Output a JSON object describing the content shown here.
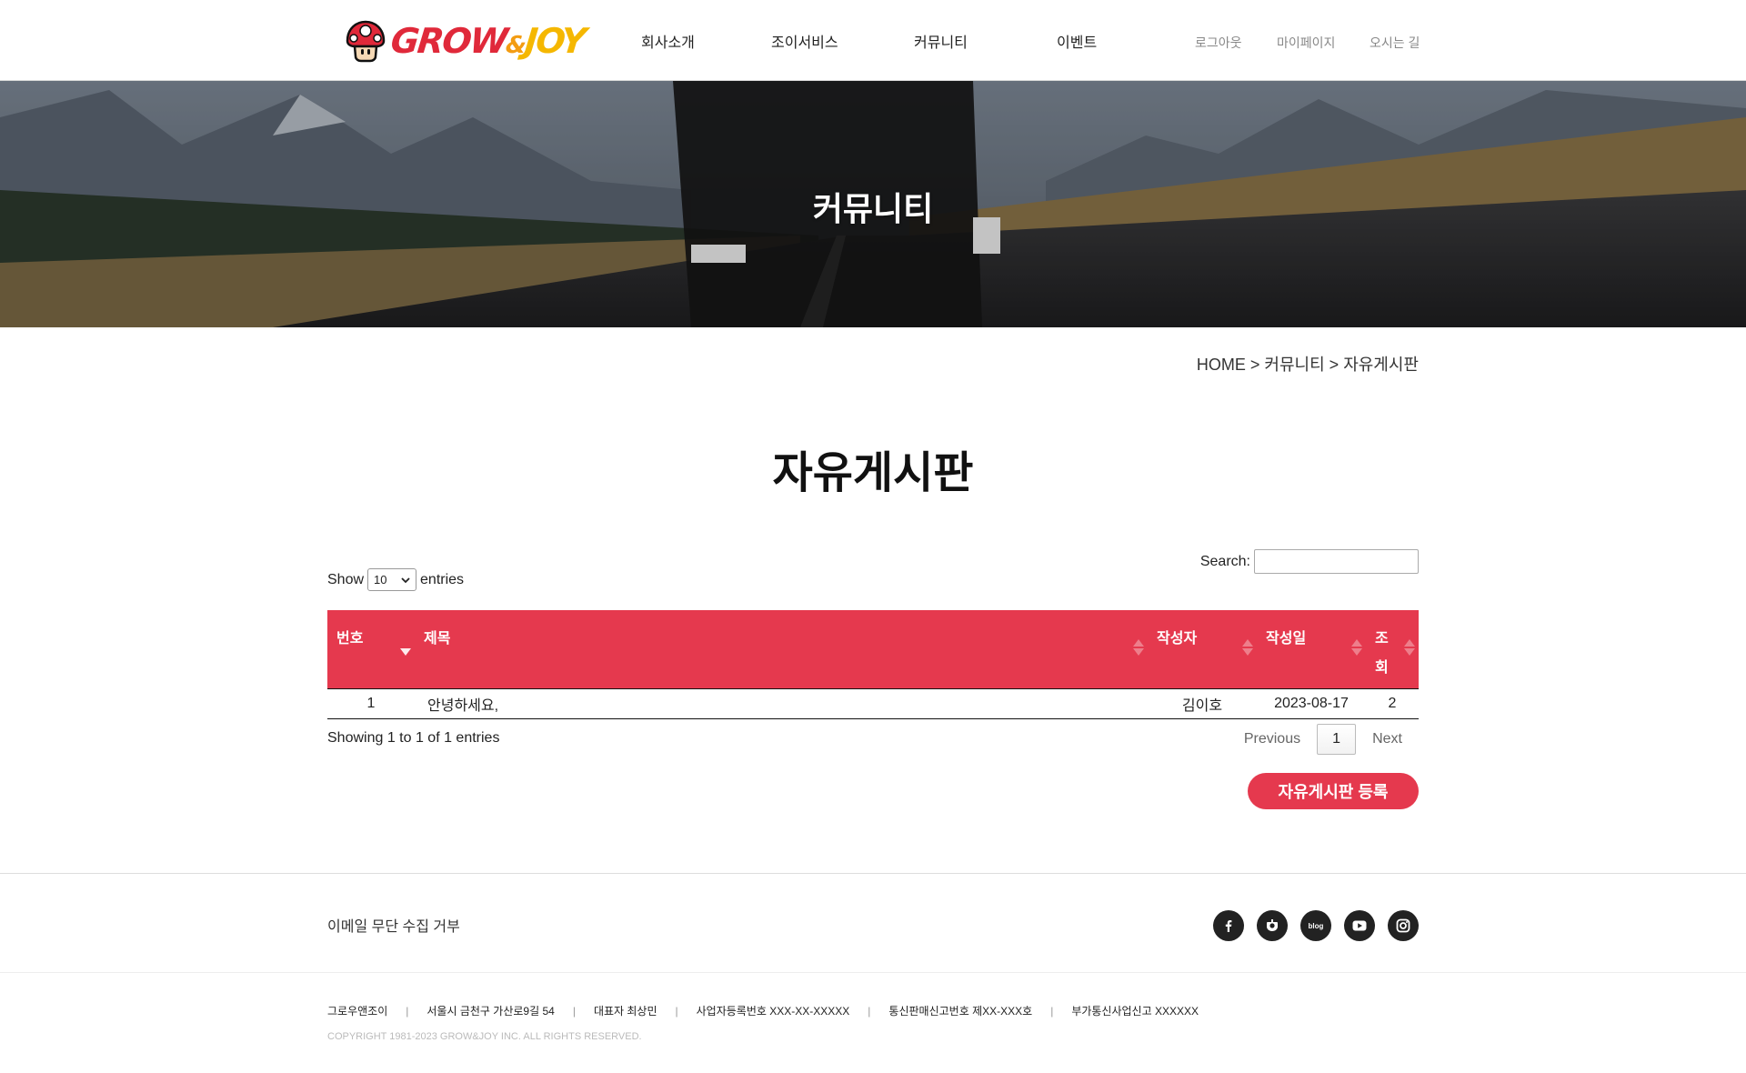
{
  "header": {
    "logo_text_grow": "GROW",
    "logo_text_amp": "&",
    "logo_text_joy": "JOY",
    "nav": [
      "회사소개",
      "조이서비스",
      "커뮤니티",
      "이벤트"
    ],
    "util": [
      "로그아웃",
      "마이페이지",
      "오시는 길"
    ]
  },
  "hero": {
    "title": "커뮤니티"
  },
  "breadcrumb": "HOME > 커뮤니티 > 자유게시판",
  "page_title": "자유게시판",
  "table_controls": {
    "show_label": "Show",
    "entries_label": "entries",
    "length_value": "10",
    "search_label": "Search:",
    "search_value": ""
  },
  "table": {
    "columns": [
      "번호",
      "제목",
      "작성자",
      "작성일",
      "조회"
    ],
    "rows": [
      {
        "no": "1",
        "title": "안녕하세요,",
        "author": "김이호",
        "date": "2023-08-17",
        "views": "2"
      }
    ]
  },
  "pagination": {
    "info": "Showing 1 to 1 of 1 entries",
    "previous": "Previous",
    "current": "1",
    "next": "Next"
  },
  "write_button": "자유게시판 등록",
  "footer": {
    "privacy": "이메일 무단 수집 거부",
    "sns": [
      "facebook-icon",
      "kakao-story-icon",
      "blog-icon",
      "youtube-icon",
      "instagram-icon"
    ],
    "sns_blog_text": "blog",
    "company_info": [
      "그로우앤조이",
      "서울시 금천구 가산로9길 54",
      "대표자 최상민",
      "사업자등록번호 XXX-XX-XXXXX",
      "통신판매신고번호 제XX-XXX호",
      "부가통신사업신고 XXXXXX"
    ],
    "copyright": "COPYRIGHT 1981-2023 GROW&JOY INC. ALL RIGHTS RESERVED."
  },
  "colors": {
    "accent": "#e5394e",
    "header_border": "#d9d9d9"
  }
}
